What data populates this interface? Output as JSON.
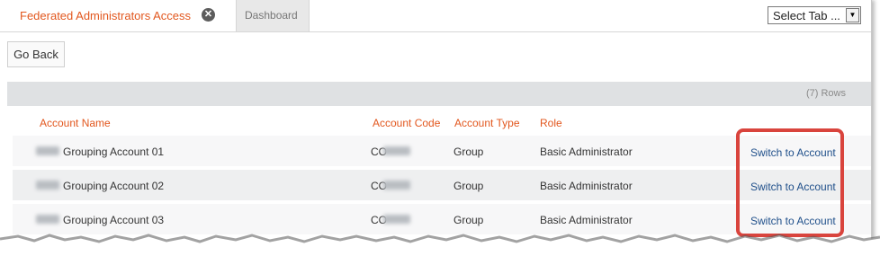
{
  "tabs": {
    "active_label": "Federated Administrators Access",
    "dashboard_label": "Dashboard",
    "select_label": "Select Tab ..."
  },
  "toolbar": {
    "go_back_label": "Go Back"
  },
  "rows_count_label": "(7) Rows",
  "table": {
    "headers": [
      "Account Name",
      "Account Code",
      "Account Type",
      "Role"
    ],
    "rows": [
      {
        "name": "Grouping Account 01",
        "code_prefix": "CO",
        "type": "Group",
        "role": "Basic Administrator",
        "action": "Switch to Account"
      },
      {
        "name": "Grouping Account 02",
        "code_prefix": "CO",
        "type": "Group",
        "role": "Basic Administrator",
        "action": "Switch to Account"
      },
      {
        "name": "Grouping Account 03",
        "code_prefix": "CO",
        "type": "Group",
        "role": "Basic Administrator",
        "action": "Switch to Account"
      }
    ]
  },
  "colors": {
    "accent": "#e2571e",
    "link": "#1f4f8a",
    "highlight": "#d9443d"
  }
}
